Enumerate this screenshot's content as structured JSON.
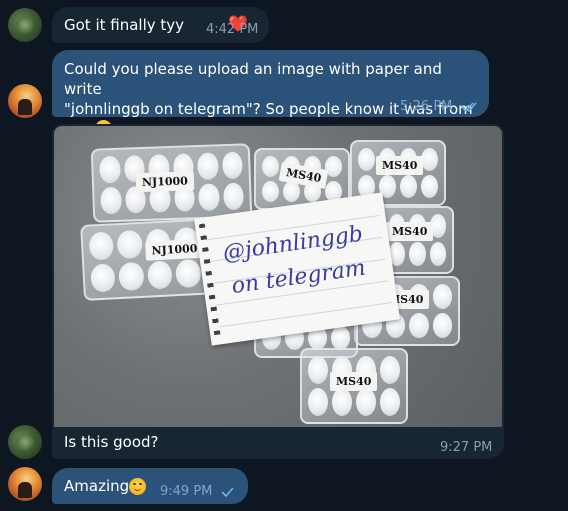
{
  "messages": [
    {
      "id": "m1",
      "side": "in",
      "text": "Got it finally tyy",
      "emoji": "❤️",
      "time": "4:42 PM"
    },
    {
      "id": "m2",
      "side": "out",
      "text_line1": "Could you please upload an image with paper and write",
      "text_line2": "\"johnlinggb on telegram\"? So people know it was from me",
      "time": "5:26 PM",
      "status": "read"
    },
    {
      "id": "m3",
      "side": "in",
      "caption": "Is this good?",
      "time": "9:27 PM",
      "photo": {
        "paper_line1": "@johnlinggb",
        "paper_line2": "on telegram",
        "case_labels": [
          "NJ1000",
          "NJ1000",
          "MS40",
          "MS40",
          "MS40",
          "MS40",
          "MS40"
        ]
      }
    },
    {
      "id": "m4",
      "side": "out",
      "text": "Amazing",
      "time": "9:49 PM",
      "status": "sent"
    }
  ],
  "colors": {
    "background": "#0e1621",
    "incoming": "#182533",
    "outgoing": "#2b5278",
    "check": "#6fb3f2"
  }
}
